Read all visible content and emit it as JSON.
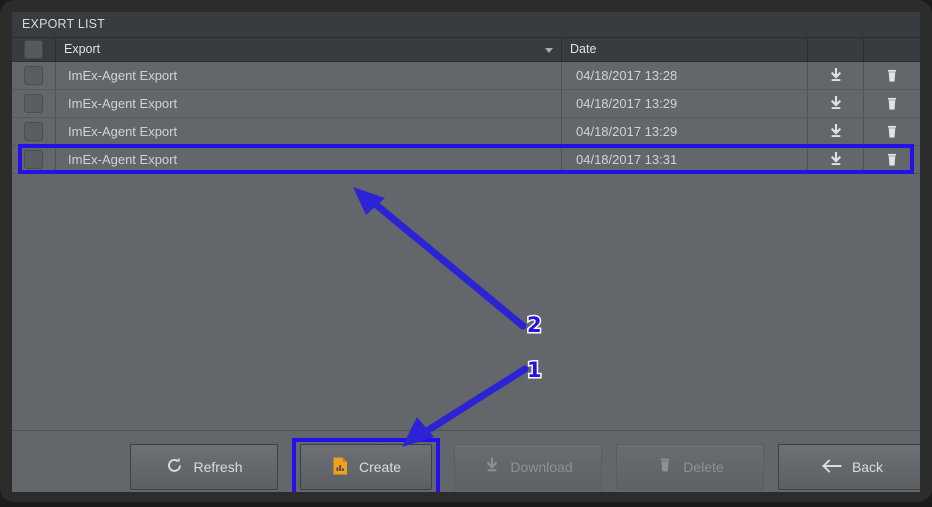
{
  "panel": {
    "title": "EXPORT LIST"
  },
  "table": {
    "columns": {
      "select_label": "",
      "export_label": "Export",
      "date_label": "Date",
      "download_label": "",
      "delete_label": "",
      "sort_indicator": "descending"
    },
    "rows": [
      {
        "selected": "false",
        "name": "ImEx-Agent Export",
        "date": "04/18/2017 13:28",
        "download_icon": "download-icon",
        "delete_icon": "trash-icon"
      },
      {
        "selected": "false",
        "name": "ImEx-Agent Export",
        "date": "04/18/2017 13:29",
        "download_icon": "download-icon",
        "delete_icon": "trash-icon"
      },
      {
        "selected": "false",
        "name": "ImEx-Agent Export",
        "date": "04/18/2017 13:29",
        "download_icon": "download-icon",
        "delete_icon": "trash-icon"
      },
      {
        "selected": "false",
        "name": "ImEx-Agent Export",
        "date": "04/18/2017 13:31",
        "download_icon": "download-icon",
        "delete_icon": "trash-icon"
      }
    ]
  },
  "buttons": {
    "refresh": {
      "label": "Refresh",
      "icon": "refresh-icon",
      "enabled": "true"
    },
    "create": {
      "label": "Create",
      "icon": "document-chart-icon",
      "enabled": "true"
    },
    "download": {
      "label": "Download",
      "icon": "download-icon",
      "enabled": "false"
    },
    "delete": {
      "label": "Delete",
      "icon": "trash-icon",
      "enabled": "false"
    },
    "back": {
      "label": "Back",
      "icon": "arrow-left-icon",
      "enabled": "true"
    }
  },
  "annotations": {
    "step_one": "1",
    "step_two": "2",
    "highlight_color": "#2410e8",
    "arrow_color": "#2b23d4"
  },
  "colors": {
    "frame": "#2c2c2c",
    "panel_header": "#383c41",
    "body": "#63676b",
    "text": "#cfd3d6",
    "create_icon": "#f0a11e"
  }
}
